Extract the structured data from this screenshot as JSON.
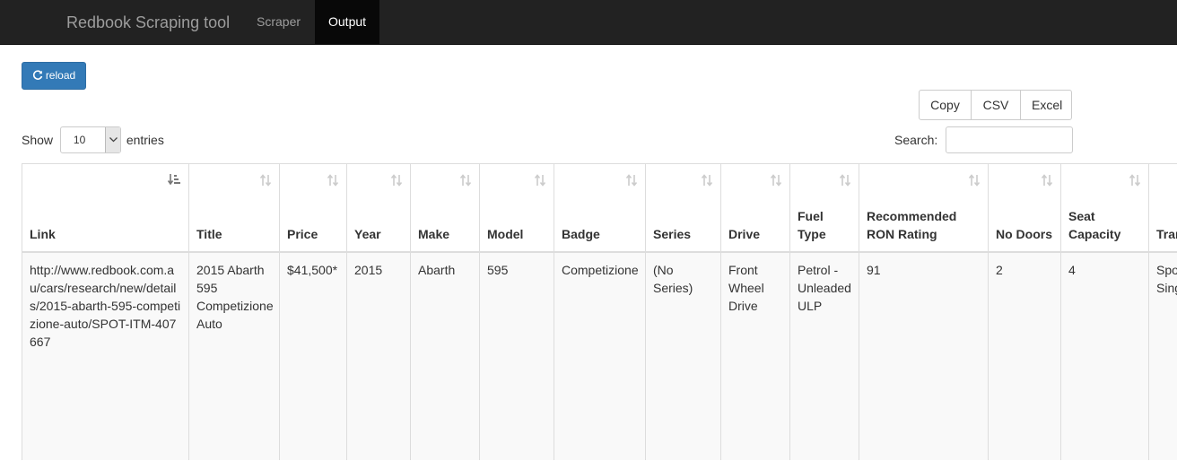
{
  "navbar": {
    "brand": "Redbook Scraping tool",
    "tabs": [
      {
        "label": "Scraper",
        "active": false
      },
      {
        "label": "Output",
        "active": true
      }
    ],
    "background": "#222222"
  },
  "reload_button": {
    "label": "reload",
    "icon": "refresh-icon",
    "color": "#337ab7"
  },
  "export_buttons": [
    "Copy",
    "CSV",
    "Excel"
  ],
  "length_control": {
    "prefix": "Show",
    "value": "10",
    "suffix": "entries"
  },
  "search": {
    "label": "Search:",
    "value": ""
  },
  "table": {
    "columns": [
      "Link",
      "Title",
      "Price",
      "Year",
      "Make",
      "Model",
      "Badge",
      "Series",
      "Drive",
      "Fuel Type",
      "Recommended RON Rating",
      "No Doors",
      "Seat Capacity",
      "Transmission"
    ],
    "sorted_column": "Link",
    "rows": [
      [
        "http://www.redbook.com.au/cars/research/new/details/2015-abarth-595-competizione-auto/SPOT-ITM-407667",
        "2015 Abarth 595 Competizione Auto",
        "$41,500*",
        "2015",
        "Abarth",
        "595",
        "Competizione",
        "(No Series)",
        "Front Wheel Drive",
        "Petrol - Unleaded ULP",
        "91",
        "2",
        "4",
        "Sports Single"
      ]
    ]
  }
}
